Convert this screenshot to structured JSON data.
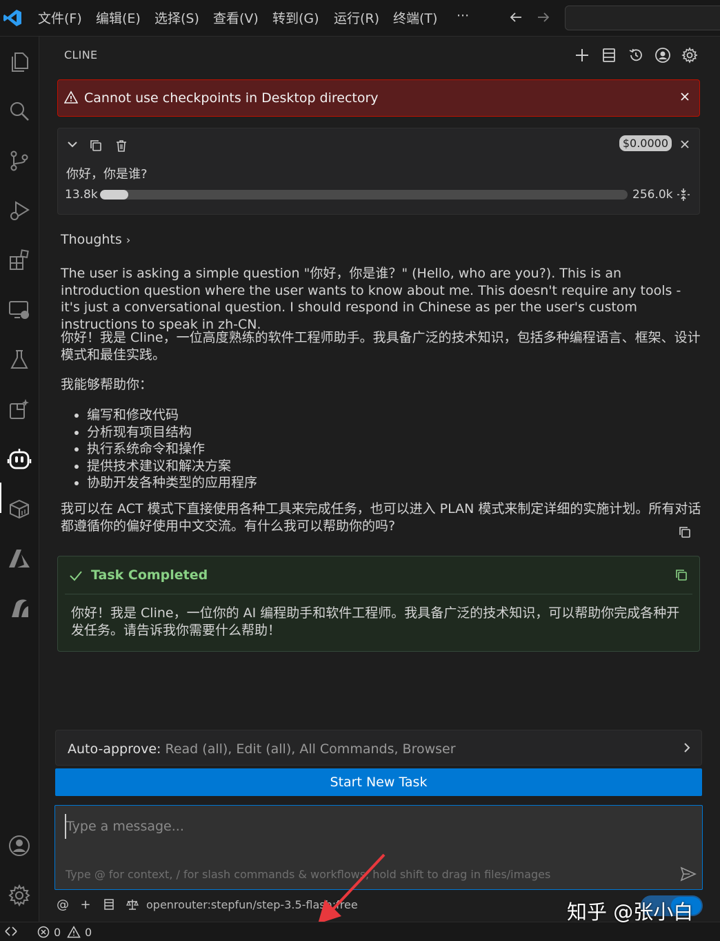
{
  "titlebar": {
    "menus": [
      "文件(F)",
      "编辑(E)",
      "选择(S)",
      "查看(V)",
      "转到(G)",
      "运行(R)",
      "终端(T)",
      "···"
    ]
  },
  "activity_bar": {
    "icons": [
      "explorer-icon",
      "search-icon",
      "source-control-icon",
      "run-debug-icon",
      "extensions-icon",
      "remote-explorer-icon",
      "testing-icon",
      "ai-extensions-icon",
      "cline-robot-icon",
      "packages-icon",
      "azure-icon",
      "deploy-icon",
      "account-icon",
      "settings-gear-icon"
    ],
    "active": "cline-robot-icon"
  },
  "panel": {
    "title": "CLINE",
    "header_icons": [
      "plus-icon",
      "server-icon",
      "history-icon",
      "account-circle-icon",
      "gear-icon"
    ]
  },
  "error_banner": {
    "text": "Cannot use checkpoints in Desktop directory"
  },
  "task": {
    "question": "你好，你是谁?",
    "cost": "$0.0000",
    "context_used": "13.8k",
    "context_total": "256.0k",
    "context_fraction": 0.054
  },
  "conversation": {
    "thoughts_label": "Thoughts",
    "thought_text": "The user is asking a simple question \"你好，你是谁？\" (Hello, who are you?). This is an introduction question where the user wants to know about me. This doesn't require any tools - it's just a conversational question. I should respond in Chinese as per the user's custom instructions to speak in zh-CN.",
    "intro": "你好！我是 Cline，一位高度熟练的软件工程师助手。我具备广泛的技术知识，包括多种编程语言、框架、设计模式和最佳实践。",
    "can_help": "我能够帮助你：",
    "bullets": [
      "编写和修改代码",
      "分析现有项目结构",
      "执行系统命令和操作",
      "提供技术建议和解决方案",
      "协助开发各种类型的应用程序"
    ],
    "closing": "我可以在 ACT 模式下直接使用各种工具来完成任务，也可以进入 PLAN 模式来制定详细的实施计划。所有对话都遵循你的偏好使用中文交流。有什么我可以帮助你的吗?"
  },
  "task_completed": {
    "title": "Task Completed",
    "text": "你好！我是 Cline，一位你的 AI 编程助手和软件工程师。我具备广泛的技术知识，可以帮助你完成各种开发任务。请告诉我你需要什么帮助！"
  },
  "auto_approve": {
    "label": "Auto-approve:",
    "value": "Read (all), Edit (all), All Commands, Browser"
  },
  "new_task_button": "Start New Task",
  "chat": {
    "placeholder": "Type a message...",
    "hint": "Type @ for context, / for slash commands & workflows, hold shift to drag in files/images"
  },
  "bottom_bar": {
    "at": "@",
    "plus": "+",
    "model": "openrouter:stepfun/step-3.5-flash:free"
  },
  "statusbar": {
    "errors": "0",
    "warnings": "0"
  },
  "watermark": "知乎 @张小白",
  "colors": {
    "accent": "#0078d4",
    "error_bg": "#5a1d1d",
    "success": "#89d185"
  }
}
